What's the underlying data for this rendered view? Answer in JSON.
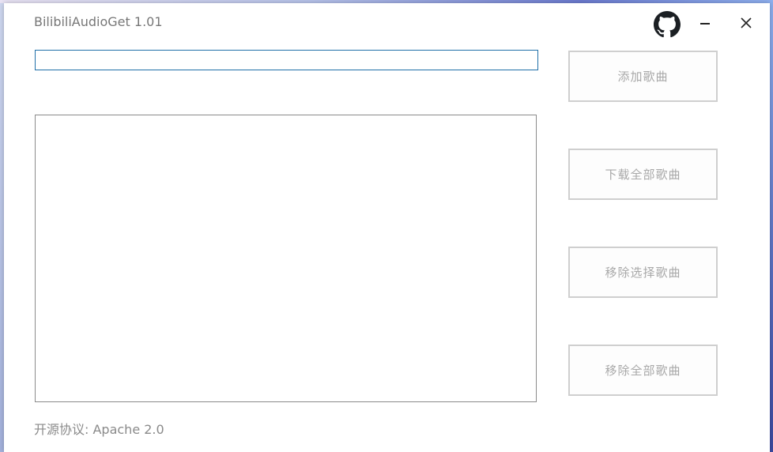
{
  "app": {
    "title": "BilibiliAudioGet 1.01"
  },
  "titlebar": {
    "github_icon": "github-icon",
    "minimize_icon": "minimize-icon",
    "close_icon": "close-icon"
  },
  "search": {
    "value": "",
    "placeholder": ""
  },
  "song_list": {
    "items": []
  },
  "actions": {
    "add_song": "添加歌曲",
    "download_all": "下载全部歌曲",
    "remove_selected": "移除选择歌曲",
    "remove_all": "移除全部歌曲"
  },
  "footer": {
    "license_text": "开源协议: Apache 2.0"
  },
  "colors": {
    "accent_border": "#1f6fa8",
    "button_text": "#a8a8a8",
    "title_text": "#777777"
  }
}
